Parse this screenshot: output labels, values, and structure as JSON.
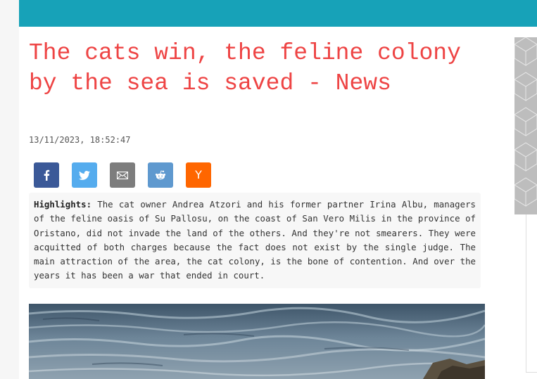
{
  "article": {
    "title": "The cats win, the feline colony by the sea is saved - News",
    "timestamp": "13/11/2023, 18:52:47",
    "highlights_label": "Highlights:",
    "highlights_text": "The cat owner Andrea Atzori and his former partner Irina Albu, managers of the feline oasis of Su Pallosu, on the coast of San Vero Milis in the province of Oristano, did not invade the land of the others. And they're not smearers. They were acquitted of both charges because the fact does not exist by the single judge. The main attraction of the area, the cat colony, is the bone of contention. And over the years it has been a war that ended in court."
  },
  "share": [
    {
      "icon": "facebook-icon",
      "color": "#3b5998"
    },
    {
      "icon": "twitter-icon",
      "color": "#55acee"
    },
    {
      "icon": "email-icon",
      "color": "#7d7d7d"
    },
    {
      "icon": "reddit-icon",
      "color": "#5f99cf"
    },
    {
      "icon": "hackernews-icon",
      "color": "#ff6600",
      "label": "Y"
    }
  ],
  "colors": {
    "topbar": "#17a2b8",
    "title": "#ee4444"
  }
}
